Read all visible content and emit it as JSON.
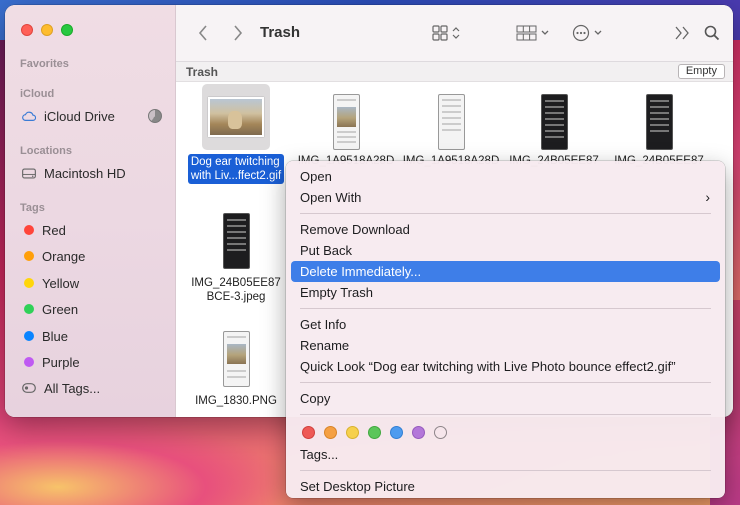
{
  "sidebar": {
    "favorites_header": "Favorites",
    "icloud_header": "iCloud",
    "icloud_drive": "iCloud Drive",
    "locations_header": "Locations",
    "macintosh_hd": "Macintosh HD",
    "tags_header": "Tags",
    "tags": [
      {
        "label": "Red",
        "color": "#ff453a"
      },
      {
        "label": "Orange",
        "color": "#ff9f0a"
      },
      {
        "label": "Yellow",
        "color": "#ffd60a"
      },
      {
        "label": "Green",
        "color": "#30d158"
      },
      {
        "label": "Blue",
        "color": "#0a84ff"
      },
      {
        "label": "Purple",
        "color": "#bf5af2"
      }
    ],
    "all_tags": "All Tags..."
  },
  "toolbar": {
    "title": "Trash",
    "back_icon": "chevron-left-icon",
    "forward_icon": "chevron-right-icon",
    "view_icon": "icon-grid-view-icon",
    "group_icon": "group-by-icon",
    "action_icon": "ellipsis-circle-icon",
    "more_icon": "double-chevron-right-icon",
    "search_icon": "search-icon"
  },
  "pathbar": {
    "title": "Trash",
    "empty_button": "Empty"
  },
  "files": {
    "f1_line1": "Dog ear twitching",
    "f1_line2": "with Liv...ffect2.gif",
    "f2": "IMG_1A9518A28D",
    "f3": "IMG_1A9518A28D",
    "f4": "IMG_24B05EE87",
    "f5": "IMG_24B05EE87",
    "f6_line1": "IMG_24B05EE87",
    "f6_line2": "BCE-3.jpeg",
    "f7": "IMG_1830.PNG"
  },
  "menu": {
    "open": "Open",
    "open_with": "Open With",
    "remove_download": "Remove Download",
    "put_back": "Put Back",
    "delete_immediately": "Delete Immediately...",
    "empty_trash": "Empty Trash",
    "get_info": "Get Info",
    "rename": "Rename",
    "quick_look": "Quick Look “Dog ear twitching with Live Photo bounce effect2.gif”",
    "copy": "Copy",
    "tag_colors": [
      "#ee5a56",
      "#f5a043",
      "#f6d04c",
      "#5cc65a",
      "#4d9bef",
      "#b377d9",
      "none"
    ],
    "tags": "Tags...",
    "set_desktop_picture": "Set Desktop Picture"
  }
}
